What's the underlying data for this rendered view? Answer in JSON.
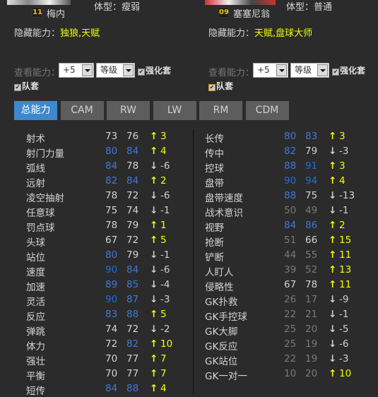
{
  "players": [
    {
      "name": "梅内",
      "number": "11",
      "body_type": "体型：瘦弱",
      "hidden_label": "隐藏能力：",
      "hidden_abilities": "独狼,天赋",
      "view_label": "查看能力：",
      "level_select": "+5",
      "grade_select": "等级",
      "enhance_set": "强化套",
      "team_set": "队套"
    },
    {
      "name": "塞塞尼翁",
      "number": "09",
      "body_type": "体型：普通",
      "hidden_label": "隐藏能力：",
      "hidden_abilities": "天赋,盘球大师",
      "view_label": "查看能力：",
      "level_select": "+5",
      "grade_select": "等级",
      "enhance_set": "强化套",
      "team_set": "队套"
    }
  ],
  "tabs": [
    {
      "label": "总能力",
      "active": true
    },
    {
      "label": "CAM"
    },
    {
      "label": "RW"
    },
    {
      "label": "LW"
    },
    {
      "label": "RM"
    },
    {
      "label": "CDM"
    }
  ],
  "colors": {
    "background": "#2b2b2b",
    "tab_active": "#3e88d0",
    "high": "#3f78d8",
    "very_high": "#1f6fd6",
    "mid": "#d4d4d4",
    "low": "#7a7a7a",
    "up": "#f2ff00",
    "down": "#d0d0d0"
  },
  "stats_left": [
    [
      "射术",
      73,
      76,
      "3"
    ],
    [
      "射门力量",
      80,
      84,
      "4"
    ],
    [
      "弧线",
      84,
      78,
      "-6"
    ],
    [
      "远射",
      82,
      84,
      "2"
    ],
    [
      "凌空抽射",
      78,
      72,
      "-6"
    ],
    [
      "任意球",
      75,
      74,
      "-1"
    ],
    [
      "罚点球",
      78,
      79,
      "1"
    ],
    [
      "头球",
      67,
      72,
      "5"
    ],
    [
      "站位",
      80,
      79,
      "-1"
    ],
    [
      "速度",
      90,
      84,
      "-6"
    ],
    [
      "加速",
      89,
      85,
      "-4"
    ],
    [
      "灵活",
      90,
      87,
      "-3"
    ],
    [
      "反应",
      83,
      88,
      "5"
    ],
    [
      "弹跳",
      74,
      72,
      "-2"
    ],
    [
      "体力",
      72,
      82,
      "10"
    ],
    [
      "强壮",
      70,
      77,
      "7"
    ],
    [
      "平衡",
      70,
      77,
      "7"
    ],
    [
      "短传",
      84,
      88,
      "4"
    ]
  ],
  "stats_right": [
    [
      "长传",
      80,
      83,
      "3"
    ],
    [
      "传中",
      82,
      79,
      "-3"
    ],
    [
      "控球",
      88,
      91,
      "3"
    ],
    [
      "盘带",
      90,
      94,
      "4"
    ],
    [
      "盘带速度",
      88,
      75,
      "-13"
    ],
    [
      "战术意识",
      50,
      49,
      "-1"
    ],
    [
      "视野",
      84,
      86,
      "2"
    ],
    [
      "抢断",
      51,
      66,
      "15"
    ],
    [
      "铲断",
      44,
      55,
      "11"
    ],
    [
      "人盯人",
      39,
      52,
      "13"
    ],
    [
      "侵略性",
      67,
      78,
      "11"
    ],
    [
      "GK扑救",
      26,
      17,
      "-9"
    ],
    [
      "GK手控球",
      22,
      21,
      "-1"
    ],
    [
      "GK大脚",
      25,
      20,
      "-5"
    ],
    [
      "GK反应",
      25,
      19,
      "-6"
    ],
    [
      "GK站位",
      22,
      19,
      "-3"
    ],
    [
      "GK一对一",
      10,
      20,
      "10"
    ]
  ]
}
